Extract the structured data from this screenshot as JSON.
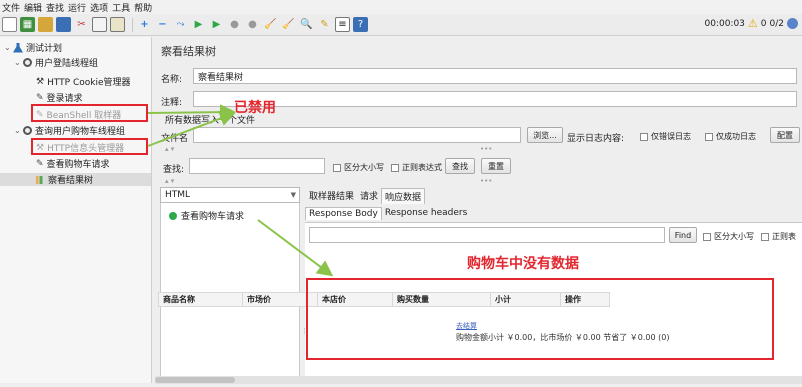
{
  "menu": [
    "文件",
    "编辑",
    "查找",
    "运行",
    "选项",
    "工具",
    "帮助"
  ],
  "status": {
    "elapsed": "00:00:03",
    "warnings": "0",
    "threads": "0/2"
  },
  "tree": {
    "plan": "测试计划",
    "group1": "用户登陆线程组",
    "cookie_manager": "HTTP Cookie管理器",
    "login_request": "登录请求",
    "beanshell": "BeanShell 取样器",
    "group2": "查询用户购物车线程组",
    "header_manager": "HTTP信息头管理器",
    "cart_request": "查看购物车请求",
    "result_tree": "察看结果树"
  },
  "panel": {
    "title": "察看结果树",
    "name_label": "名称:",
    "name_value": "察看结果树",
    "comment_label": "注释:",
    "file_section": "所有数据写入一个文件",
    "filename_label": "文件名",
    "browse": "浏览...",
    "log_label": "显示日志内容:",
    "errors_only": "仅错误日志",
    "success_only": "仅成功日志",
    "configure": "配置",
    "search_label": "查找:",
    "case_sensitive": "区分大小写",
    "regex": "正则表达式",
    "search_btn": "查找",
    "reset_btn": "重置",
    "renderer": "HTML",
    "result_item": "查看购物车请求",
    "tabs": [
      "取样器结果",
      "请求",
      "响应数据"
    ],
    "subtabs": [
      "Response Body",
      "Response headers"
    ],
    "find_btn": "Find",
    "find_case": "区分大小写",
    "find_regex": "正则表"
  },
  "cart": {
    "headers": [
      "商品名称",
      "市场价",
      "本店价",
      "购买数量",
      "小计",
      "操作"
    ],
    "link": "去结算",
    "summary": "购物金额小计 ￥0.00，比市场价 ￥0.00 节省了 ￥0.00 (0)"
  },
  "annotations": {
    "disabled": "已禁用",
    "no_data": "购物车中没有数据"
  },
  "colors": {
    "annotation": "#e3262e",
    "arrow": "#8bc34a"
  }
}
